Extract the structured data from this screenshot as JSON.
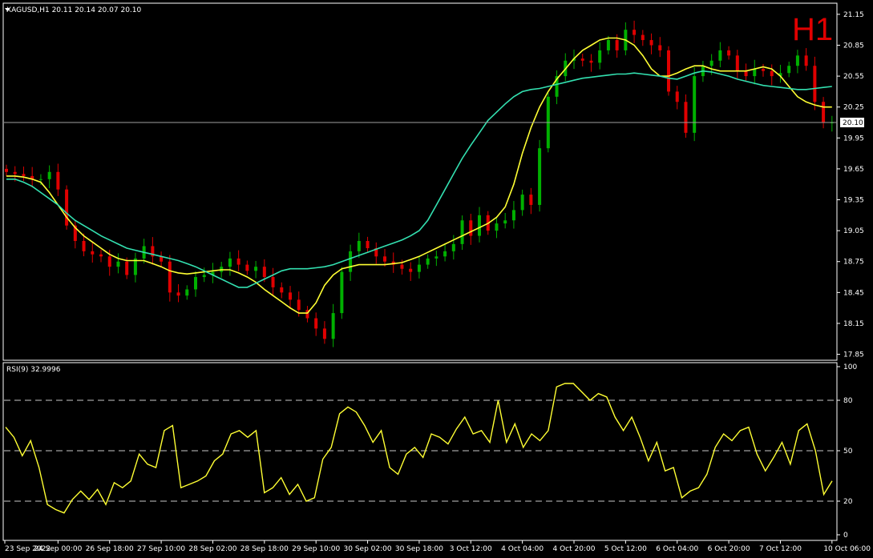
{
  "window": {
    "header": "XAGUSD,H1  20.11 20.14 20.07 20.10",
    "timeframe": "H1"
  },
  "colors": {
    "background": "#000000",
    "grid": "#ffffff",
    "bull": "#00b000",
    "bear": "#e00000",
    "ma_fast": "#ffff33",
    "ma_slow": "#33e0b0",
    "rsi": "#ffff33",
    "price_line": "#a0a0a0"
  },
  "chart_data": [
    {
      "type": "line",
      "title": "XAGUSD,H1  20.11 20.14 20.07 20.10",
      "symbol": "XAGUSD",
      "ohlc": {
        "open": 20.11,
        "high": 20.14,
        "low": 20.07,
        "close": 20.1
      },
      "current_price": "20.10",
      "ylim": [
        17.8,
        21.25
      ],
      "y_ticks": [
        "21.15",
        "20.85",
        "20.55",
        "20.25",
        "19.95",
        "19.65",
        "19.35",
        "19.05",
        "18.75",
        "18.45",
        "18.15",
        "17.85"
      ],
      "x_ticks": [
        "23 Sep 2022",
        "24 Sep 00:00",
        "26 Sep 18:00",
        "27 Sep 10:00",
        "28 Sep 02:00",
        "28 Sep 18:00",
        "29 Sep 10:00",
        "30 Sep 02:00",
        "30 Sep 18:00",
        "3 Oct 12:00",
        "4 Oct 04:00",
        "4 Oct 20:00",
        "5 Oct 12:00",
        "6 Oct 04:00",
        "6 Oct 20:00",
        "7 Oct 12:00",
        "10 Oct 06:00"
      ],
      "x_index": [
        0,
        6,
        12,
        18,
        24,
        30,
        36,
        42,
        48,
        54,
        60,
        66,
        72,
        78,
        84,
        90,
        96
      ],
      "series": [
        {
          "kind": "close",
          "values": [
            19.62,
            19.6,
            19.58,
            19.55,
            19.55,
            19.62,
            19.45,
            19.1,
            18.95,
            18.85,
            18.82,
            18.8,
            18.7,
            18.75,
            18.62,
            18.78,
            18.9,
            18.8,
            18.75,
            18.45,
            18.42,
            18.48,
            18.6,
            18.62,
            18.65,
            18.7,
            18.78,
            18.72,
            18.66,
            18.7,
            18.6,
            18.5,
            18.45,
            18.38,
            18.28,
            18.2,
            18.1,
            18.0,
            18.25,
            18.65,
            18.85,
            18.95,
            18.88,
            18.8,
            18.75,
            18.72,
            18.68,
            18.65,
            18.72,
            18.78,
            18.8,
            18.85,
            18.92,
            19.15,
            19.0,
            19.2,
            19.05,
            19.12,
            19.15,
            19.25,
            19.4,
            19.3,
            19.85,
            20.35,
            20.55,
            20.7,
            20.72,
            20.7,
            20.68,
            20.8,
            20.9,
            20.8,
            21.0,
            20.95,
            20.9,
            20.85,
            20.8,
            20.4,
            20.3,
            20.0,
            20.55,
            20.65,
            20.7,
            20.8,
            20.75,
            20.6,
            20.55,
            20.62,
            20.6,
            20.55,
            20.58,
            20.65,
            20.75,
            20.65,
            20.3,
            20.1,
            20.1
          ]
        },
        {
          "kind": "ma_fast",
          "values": [
            19.58,
            19.58,
            19.57,
            19.55,
            19.52,
            19.42,
            19.3,
            19.18,
            19.08,
            19.0,
            18.94,
            18.88,
            18.82,
            18.78,
            18.76,
            18.76,
            18.76,
            18.73,
            18.7,
            18.66,
            18.64,
            18.63,
            18.64,
            18.65,
            18.66,
            18.67,
            18.67,
            18.64,
            18.6,
            18.55,
            18.48,
            18.42,
            18.36,
            18.3,
            18.25,
            18.25,
            18.35,
            18.52,
            18.62,
            18.68,
            18.7,
            18.72,
            18.72,
            18.72,
            18.72,
            18.73,
            18.74,
            18.77,
            18.8,
            18.84,
            18.88,
            18.92,
            18.96,
            19.0,
            19.04,
            19.08,
            19.12,
            19.18,
            19.28,
            19.5,
            19.8,
            20.05,
            20.25,
            20.4,
            20.52,
            20.62,
            20.72,
            20.8,
            20.85,
            20.9,
            20.92,
            20.92,
            20.9,
            20.85,
            20.75,
            20.62,
            20.55,
            20.55,
            20.58,
            20.62,
            20.65,
            20.65,
            20.62,
            20.6,
            20.6,
            20.6,
            20.6,
            20.62,
            20.64,
            20.62,
            20.55,
            20.45,
            20.35,
            20.3,
            20.27,
            20.25,
            20.25
          ]
        },
        {
          "kind": "ma_slow",
          "values": [
            19.55,
            19.55,
            19.52,
            19.48,
            19.42,
            19.36,
            19.3,
            19.22,
            19.15,
            19.1,
            19.05,
            19.0,
            18.96,
            18.92,
            18.88,
            18.86,
            18.84,
            18.82,
            18.8,
            18.78,
            18.76,
            18.73,
            18.7,
            18.66,
            18.62,
            18.58,
            18.54,
            18.5,
            18.5,
            18.54,
            18.58,
            18.62,
            18.66,
            18.68,
            18.68,
            18.68,
            18.69,
            18.7,
            18.72,
            18.75,
            18.78,
            18.81,
            18.84,
            18.87,
            18.9,
            18.93,
            18.96,
            19.0,
            19.05,
            19.15,
            19.3,
            19.45,
            19.6,
            19.75,
            19.88,
            20.0,
            20.12,
            20.2,
            20.28,
            20.35,
            20.4,
            20.42,
            20.43,
            20.45,
            20.47,
            20.49,
            20.51,
            20.53,
            20.54,
            20.55,
            20.56,
            20.57,
            20.57,
            20.58,
            20.57,
            20.56,
            20.55,
            20.53,
            20.52,
            20.55,
            20.58,
            20.6,
            20.59,
            20.57,
            20.55,
            20.52,
            20.5,
            20.48,
            20.46,
            20.45,
            20.44,
            20.43,
            20.42,
            20.42,
            20.43,
            20.44,
            20.45
          ]
        }
      ]
    },
    {
      "type": "line",
      "title": "RSI(9) 32.9996",
      "ylim": [
        0,
        100
      ],
      "y_ticks": [
        "100",
        "80",
        "50",
        "20",
        "0"
      ],
      "levels": [
        80,
        50,
        20
      ],
      "series": [
        {
          "name": "RSI(9)",
          "values": [
            64,
            58,
            47,
            56,
            40,
            18,
            15,
            13,
            21,
            26,
            21,
            27,
            18,
            31,
            28,
            32,
            48,
            42,
            40,
            62,
            65,
            28,
            30,
            32,
            35,
            44,
            48,
            60,
            62,
            58,
            62,
            25,
            28,
            34,
            24,
            30,
            20,
            22,
            45,
            52,
            72,
            76,
            73,
            65,
            55,
            62,
            40,
            36,
            48,
            52,
            46,
            60,
            58,
            54,
            63,
            70,
            60,
            62,
            55,
            80,
            55,
            66,
            52,
            60,
            56,
            62,
            88,
            90,
            90,
            85,
            80,
            84,
            82,
            70,
            62,
            70,
            58,
            44,
            55,
            38,
            40,
            22,
            26,
            28,
            36,
            52,
            60,
            56,
            62,
            64,
            48,
            38,
            46,
            55,
            42,
            62,
            66,
            50,
            24,
            32
          ]
        }
      ]
    }
  ]
}
